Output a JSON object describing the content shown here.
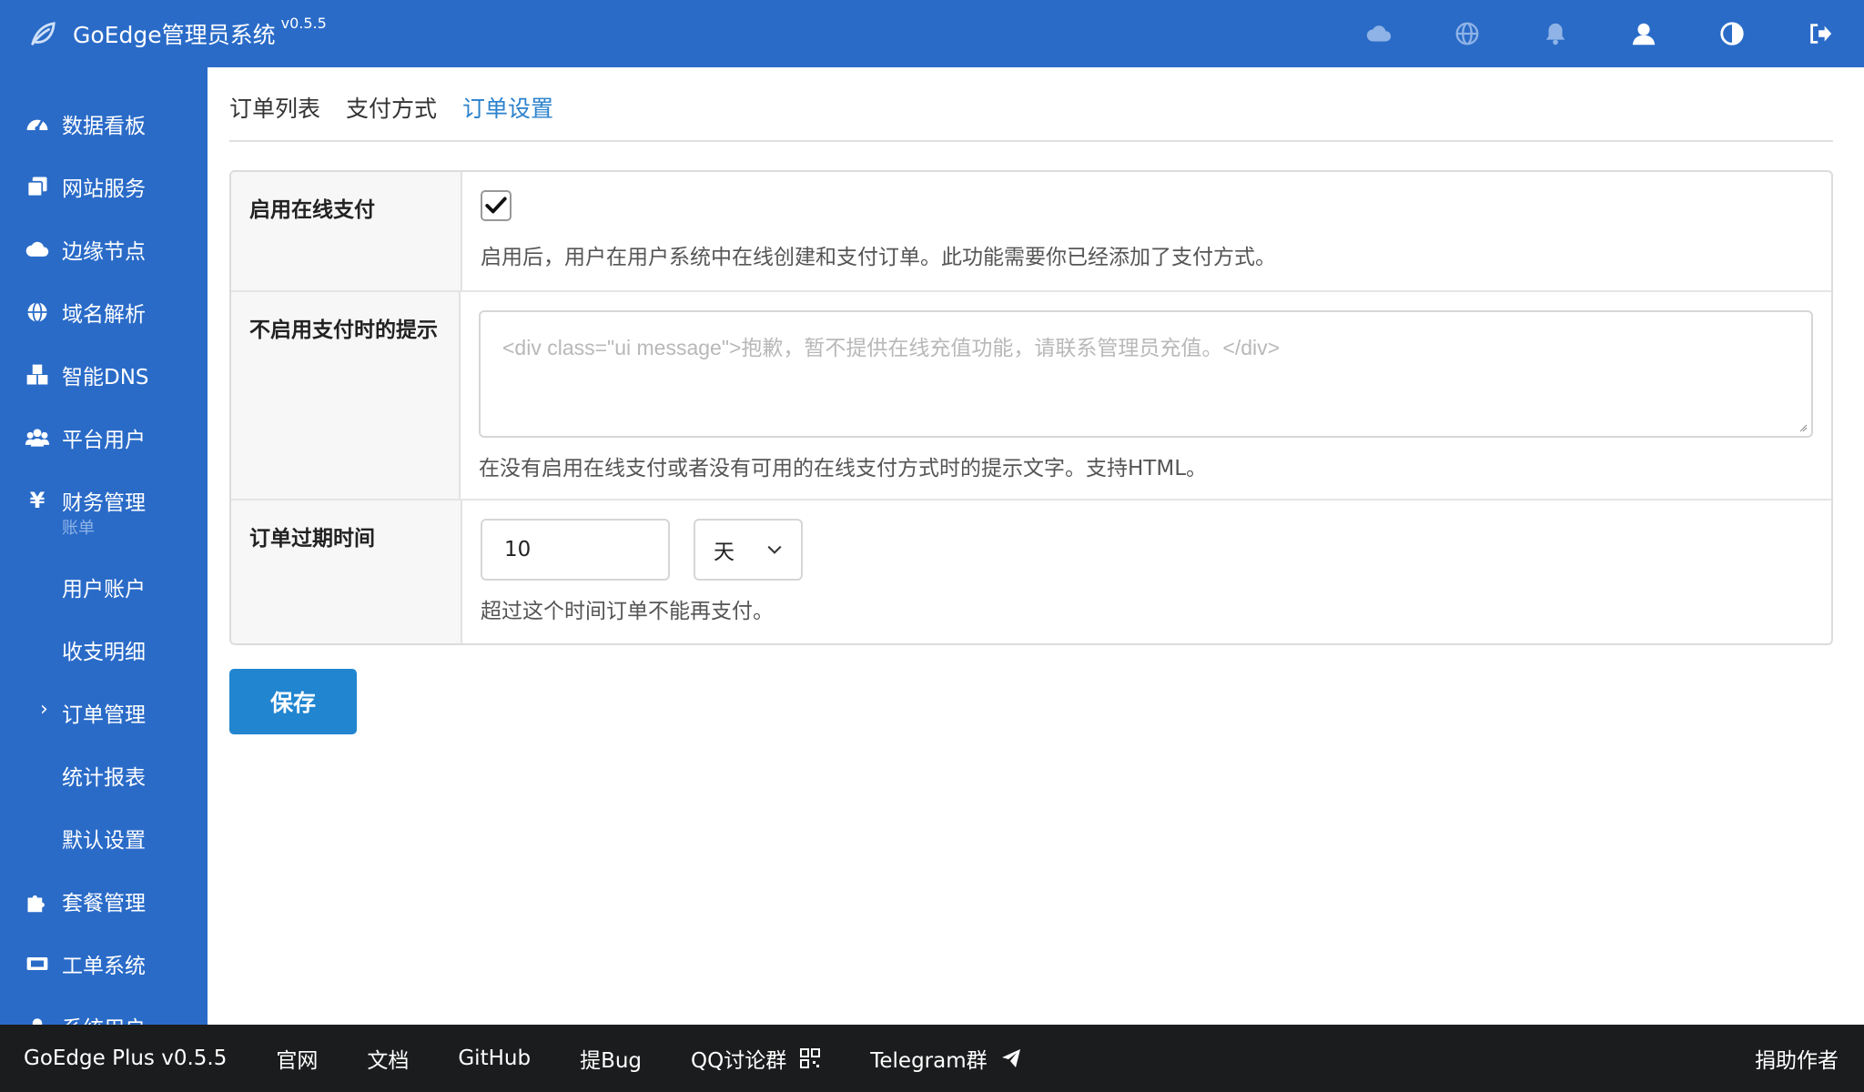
{
  "header": {
    "title": "GoEdge管理员系统",
    "version": "v0.5.5",
    "icons": [
      "cloud-icon",
      "globe-icon",
      "bell-icon",
      "user-icon",
      "contrast-icon",
      "logout-icon"
    ]
  },
  "sidebar": {
    "items": [
      {
        "label": "数据看板",
        "icon": "dashboard-icon"
      },
      {
        "label": "网站服务",
        "icon": "clone-icon"
      },
      {
        "label": "边缘节点",
        "icon": "cloud-icon"
      },
      {
        "label": "域名解析",
        "icon": "globe-icon"
      },
      {
        "label": "智能DNS",
        "icon": "cubes-icon"
      },
      {
        "label": "平台用户",
        "icon": "users-icon"
      },
      {
        "label": "财务管理",
        "icon": "yen-icon",
        "sub": "账单"
      },
      {
        "label": "套餐管理",
        "icon": "puzzle-icon"
      },
      {
        "label": "工单系统",
        "icon": "ticket-icon"
      },
      {
        "label": "系统用户",
        "icon": "user-secret-icon"
      }
    ],
    "finance_children": [
      "用户账户",
      "收支明细",
      "订单管理",
      "统计报表",
      "默认设置"
    ],
    "active_child": "订单管理"
  },
  "tabs": [
    {
      "label": "订单列表",
      "active": false
    },
    {
      "label": "支付方式",
      "active": false
    },
    {
      "label": "订单设置",
      "active": true
    }
  ],
  "form": {
    "enable_online_pay": {
      "label": "启用在线支付",
      "checked": true,
      "help": "启用后，用户在用户系统中在线创建和支付订单。此功能需要你已经添加了支付方式。"
    },
    "disabled_tip": {
      "label": "不启用支付时的提示",
      "placeholder": "<div class=\"ui message\">抱歉，暂不提供在线充值功能，请联系管理员充值。</div>",
      "help": "在没有启用在线支付或者没有可用的在线支付方式时的提示文字。支持HTML。"
    },
    "expire_time": {
      "label": "订单过期时间",
      "value": "10",
      "unit": "天",
      "help": "超过这个时间订单不能再支付。"
    },
    "save_label": "保存"
  },
  "footer": {
    "items": [
      "GoEdge Plus v0.5.5",
      "官网",
      "文档",
      "GitHub",
      "提Bug",
      "QQ讨论群",
      "Telegram群"
    ],
    "right": "捐助作者"
  },
  "colors": {
    "primary": "#2a6bc8",
    "button": "#2185d0",
    "active_tab": "#2a81cc",
    "footer_bg": "#1b1c1d"
  }
}
